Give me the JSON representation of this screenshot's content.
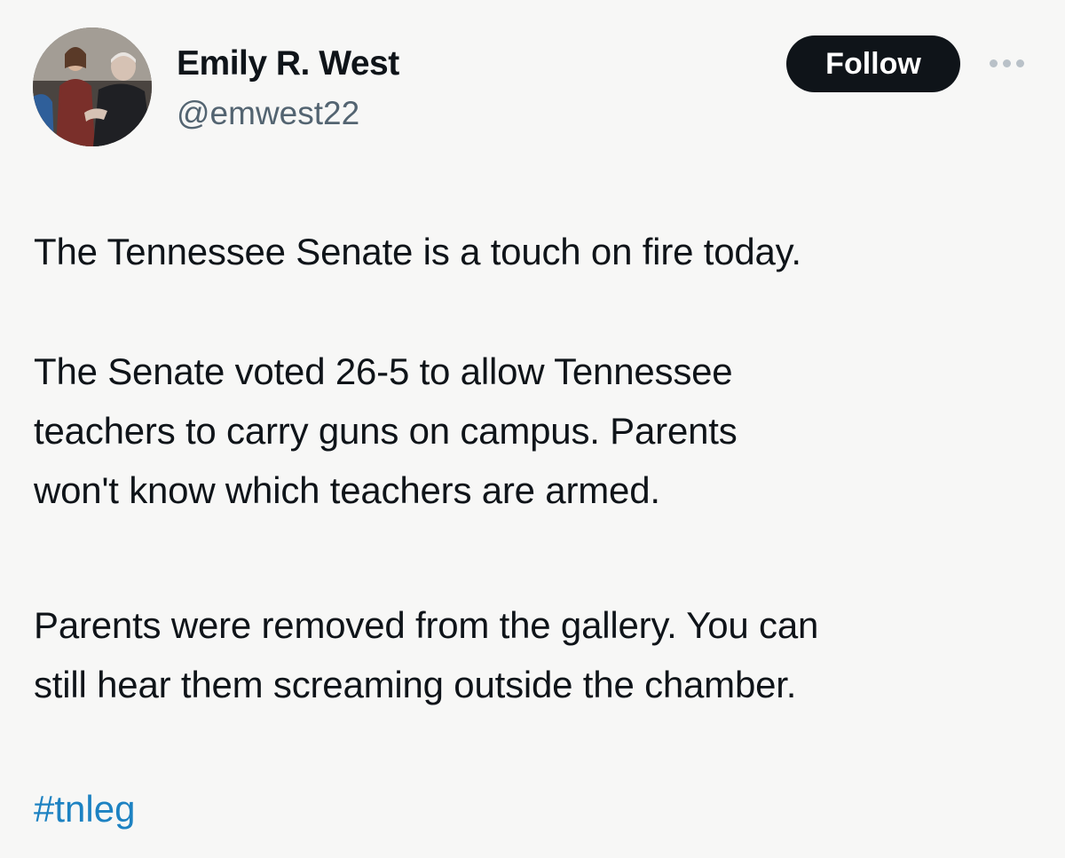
{
  "author": {
    "display_name": "Emily R. West",
    "handle": "@emwest22"
  },
  "actions": {
    "follow_label": "Follow",
    "more_icon": "more-horizontal-icon"
  },
  "tweet": {
    "paragraph_1": [
      "The Tennessee Senate is a touch on fire today."
    ],
    "paragraph_2": [
      "The Senate voted 26-5 to allow Tennessee",
      "teachers to carry guns on campus. Parents",
      "won't know which teachers are armed."
    ],
    "paragraph_3": [
      "Parents were removed from the gallery. You can",
      "still hear them screaming outside the chamber."
    ],
    "hashtag": "#tnleg"
  },
  "colors": {
    "background": "#f7f7f6",
    "text": "#0f1419",
    "secondary_text": "#536471",
    "follow_button": "#0f1419",
    "hashtag": "#1d82c2"
  }
}
